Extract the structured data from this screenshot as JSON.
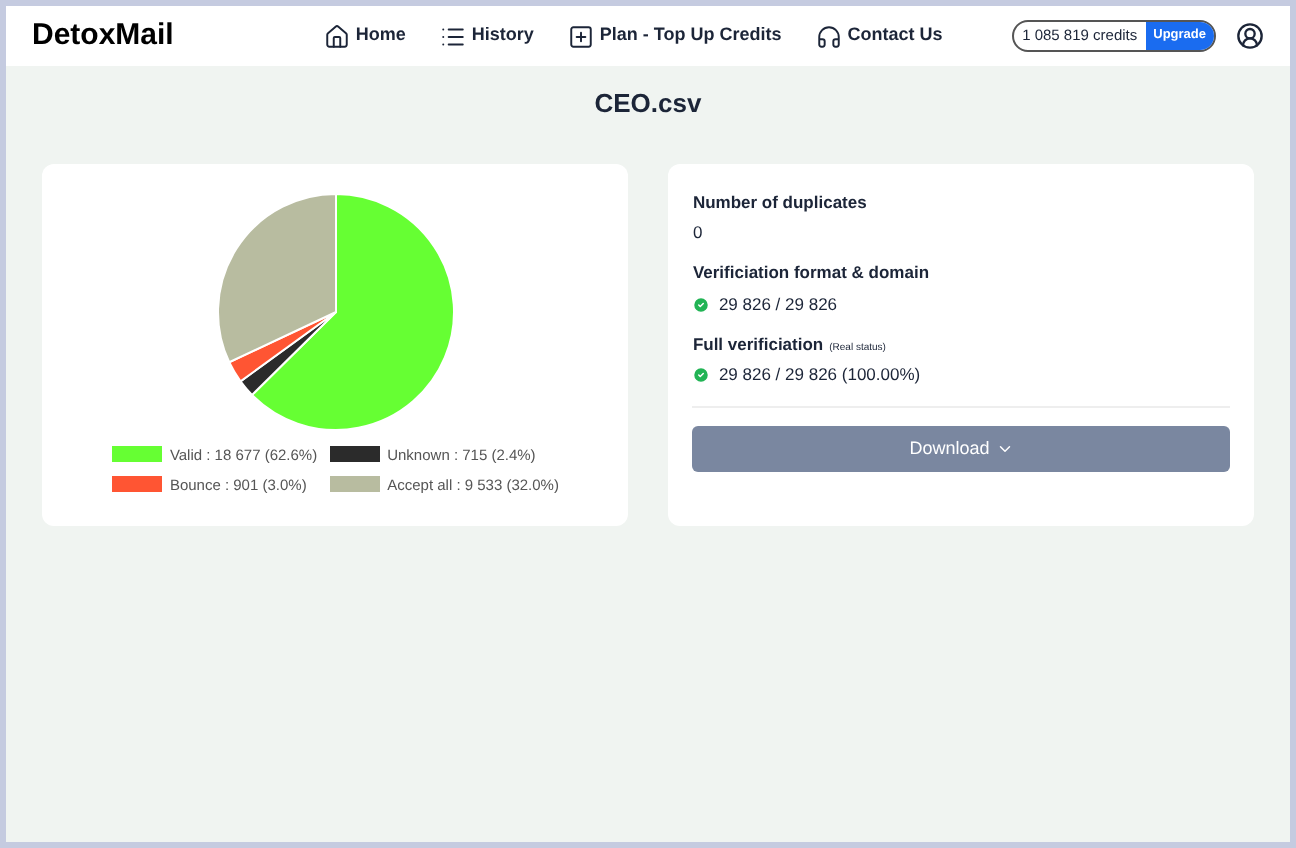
{
  "header": {
    "logo": "DetoxMail",
    "nav": [
      {
        "label": "Home"
      },
      {
        "label": "History"
      },
      {
        "label": "Plan - Top Up Credits"
      },
      {
        "label": "Contact Us"
      }
    ],
    "credits": "1 085 819 credits",
    "upgrade": "Upgrade"
  },
  "title": "CEO.csv",
  "chart_data": {
    "type": "pie",
    "values": [
      62.6,
      2.4,
      3.0,
      32.0
    ]
  },
  "legend": [
    {
      "label": "Valid : 18 677 (62.6%)",
      "color": "#66ff33"
    },
    {
      "label": "Unknown : 715 (2.4%)",
      "color": "#2b2b2b"
    },
    {
      "label": "Bounce : 901 (3.0%)",
      "color": "#ff5533"
    },
    {
      "label": "Accept all : 9 533 (32.0%)",
      "color": "#b8bca0"
    }
  ],
  "stats": [
    {
      "heading": "Number of duplicates",
      "value": "0",
      "checked": false
    },
    {
      "heading": "Verificiation format & domain",
      "value": "29 826 / 29 826",
      "checked": true
    },
    {
      "heading": "Full verificiation",
      "note": "(Real status)",
      "value": "29 826 / 29 826 (100.00%)",
      "checked": true
    }
  ],
  "download": "Download"
}
